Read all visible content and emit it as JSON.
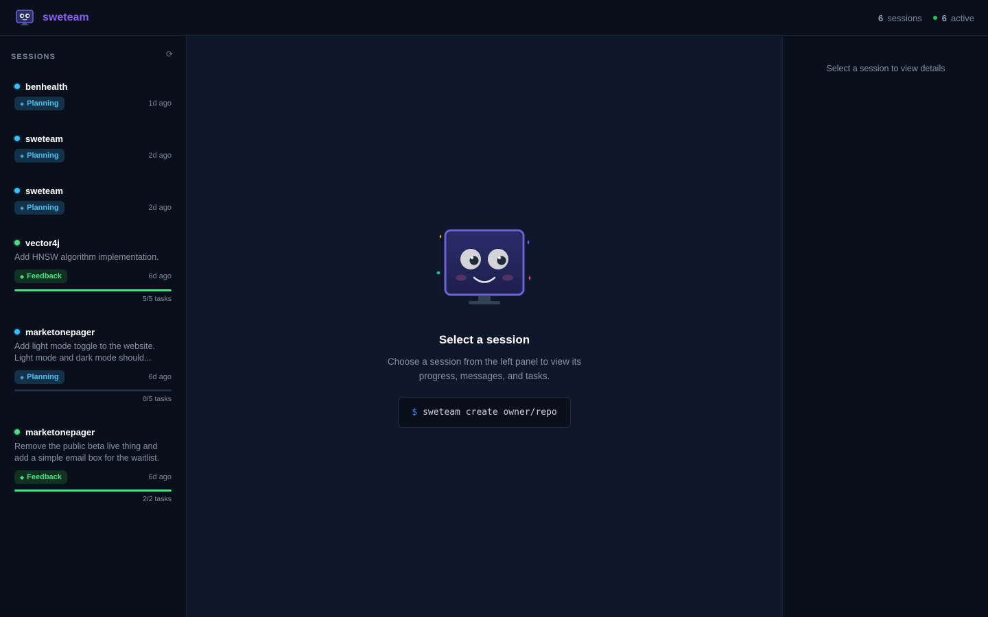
{
  "app": {
    "title": "sweteam",
    "logo_icon": "robot-monitor-icon"
  },
  "header": {
    "sessions_count": "6",
    "sessions_label": "sessions",
    "active_count": "6",
    "active_label": "active",
    "active_color": "#22c55e"
  },
  "sidebar": {
    "heading": "SESSIONS",
    "refresh_icon": "⟳",
    "sessions": [
      {
        "name": "benhealth",
        "status_color": "#38bdf8",
        "description": "",
        "badge": "Planning",
        "badge_icon": "◈",
        "time": "1d ago",
        "tasks": "",
        "progress": null
      },
      {
        "name": "sweteam",
        "status_color": "#38bdf8",
        "description": "",
        "badge": "Planning",
        "badge_icon": "◈",
        "time": "2d ago",
        "tasks": "",
        "progress": null
      },
      {
        "name": "sweteam",
        "status_color": "#38bdf8",
        "description": "",
        "badge": "Planning",
        "badge_icon": "◈",
        "time": "2d ago",
        "tasks": "",
        "progress": null
      },
      {
        "name": "vector4j",
        "status_color": "#4ade80",
        "description": "Add HNSW algorithm implementation.",
        "badge": "Feedback",
        "badge_icon": "◆",
        "time": "6d ago",
        "tasks": "5/5 tasks",
        "progress": 1.0
      },
      {
        "name": "marketonepager",
        "status_color": "#38bdf8",
        "description": "Add light mode toggle to the website. Light mode and dark mode should...",
        "badge": "Planning",
        "badge_icon": "◈",
        "time": "6d ago",
        "tasks": "0/5 tasks",
        "progress": 0.0
      },
      {
        "name": "marketonepager",
        "status_color": "#4ade80",
        "description": "Remove the public beta live thing and add a simple email box for the waitlist.",
        "badge": "Feedback",
        "badge_icon": "◆",
        "time": "6d ago",
        "tasks": "2/2 tasks",
        "progress": 1.0
      }
    ]
  },
  "main": {
    "illustration": "robot-monitor-mascot-icon",
    "title": "Select a session",
    "subtitle": "Choose a session from the left panel to view its progress, messages, and tasks.",
    "command_prompt": "$",
    "command": "sweteam create owner/repo"
  },
  "details": {
    "empty_text": "Select a session to view details"
  }
}
